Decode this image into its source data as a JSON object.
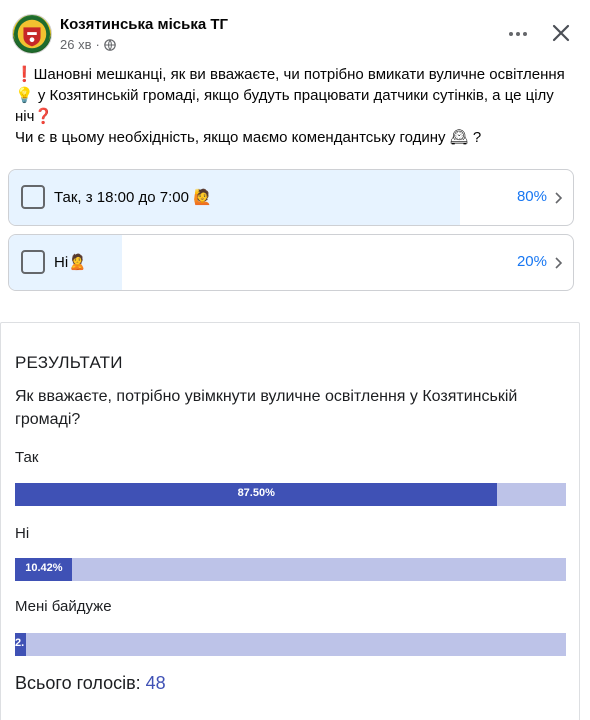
{
  "post": {
    "author": "Козятинська міська ТГ",
    "time": "26 хв",
    "privacy_icon": "globe-icon",
    "text_line1": "❗Шановні мешканці, як ви вважаєте, чи потрібно вмикати вуличне освітлення",
    "text_line2": "💡 у Козятинській громаді, якщо будуть працювати датчики сутінків, а це цілу",
    "text_line3": "ніч❓",
    "text_line4": "Чи є в цьому необхідність, якщо маємо комендантську годину 🕰 ?"
  },
  "poll": {
    "options": [
      {
        "label": "Так, з 18:00 до 7:00 🙋",
        "percent_text": "80%",
        "share": 0.8
      },
      {
        "label": "Ні🙎",
        "percent_text": "20%",
        "share": 0.2
      }
    ]
  },
  "results": {
    "title": "РЕЗУЛЬТАТИ",
    "question": "Як вважаєте, потрібно увімкнути вуличне освітлення у Козятинській громаді?",
    "answers": [
      {
        "label": "Так",
        "value_text": "87.50%",
        "share": 0.875
      },
      {
        "label": "Ні",
        "value_text": "10.42%",
        "share": 0.1042
      },
      {
        "label": "Мені байдуже",
        "value_text": "2.",
        "share": 0.0208
      }
    ],
    "total_label": "Всього голосів:",
    "total_count": "48"
  },
  "colors": {
    "accent_blue": "#1877f2",
    "poll_fill": "#e7f3ff",
    "result_bar": "#3f51b5",
    "result_track": "#bdc3e8"
  }
}
